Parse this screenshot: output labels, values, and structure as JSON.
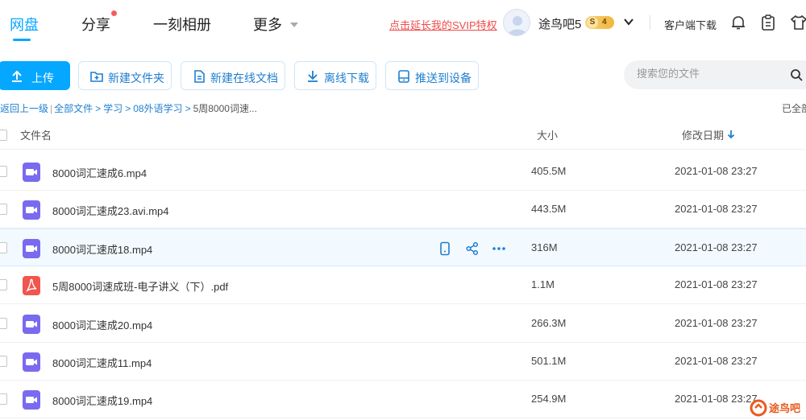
{
  "nav": {
    "tabs": [
      "网盘",
      "分享",
      "一刻相册",
      "更多"
    ],
    "svip_link": "点击延长我的SVIP特权",
    "username": "途鸟吧5",
    "vip_badge": {
      "prefix": "S",
      "level": "4"
    },
    "client_download": "客户端下载",
    "icons": [
      "bell-icon",
      "clipboard-icon",
      "shirt-icon"
    ]
  },
  "toolbar": {
    "upload": "上传",
    "new_folder": "新建文件夹",
    "new_doc": "新建在线文档",
    "offline_download": "离线下载",
    "push_device": "推送到设备",
    "search_placeholder": "搜索您的文件"
  },
  "breadcrumb": {
    "back": "返回上一级",
    "items": [
      "全部文件",
      "学习",
      "08外语学习",
      "5周8000词速..."
    ],
    "loaded": "已全部"
  },
  "table": {
    "headers": {
      "name": "文件名",
      "size": "大小",
      "date": "修改日期"
    },
    "rows": [
      {
        "name": "8000词汇速成6.mp4",
        "size": "405.5M",
        "date": "2021-01-08 23:27",
        "type": "video"
      },
      {
        "name": "8000词汇速成23.avi.mp4",
        "size": "443.5M",
        "date": "2021-01-08 23:27",
        "type": "video"
      },
      {
        "name": "8000词汇速成18.mp4",
        "size": "316M",
        "date": "2021-01-08 23:27",
        "type": "video"
      },
      {
        "name": "5周8000词速成班-电子讲义（下）.pdf",
        "size": "1.1M",
        "date": "2021-01-08 23:27",
        "type": "pdf"
      },
      {
        "name": "8000词汇速成20.mp4",
        "size": "266.3M",
        "date": "2021-01-08 23:27",
        "type": "video"
      },
      {
        "name": "8000词汇速成11.mp4",
        "size": "501.1M",
        "date": "2021-01-08 23:27",
        "type": "video"
      },
      {
        "name": "8000词汇速成19.mp4",
        "size": "254.9M",
        "date": "2021-01-08 23:27",
        "type": "video"
      }
    ],
    "hover_actions": [
      "phone-icon",
      "share-icon",
      "more-icon"
    ]
  },
  "watermark": "途鸟吧",
  "colors": {
    "accent": "#06a7ff",
    "link": "#1f7fd0",
    "svip": "#f04b4b",
    "video": "#7a6af0",
    "pdf": "#f0554e"
  }
}
